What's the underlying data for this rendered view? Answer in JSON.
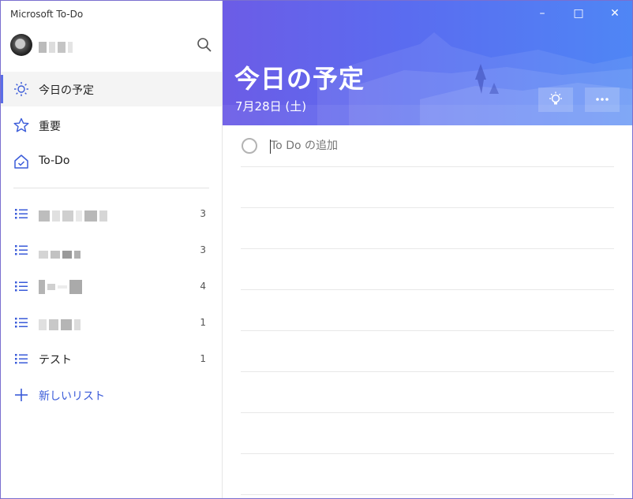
{
  "window": {
    "title": "Microsoft To-Do"
  },
  "user": {
    "name": ""
  },
  "nav": [
    {
      "label": "今日の予定",
      "icon": "sun-icon"
    },
    {
      "label": "重要",
      "icon": "star-icon"
    },
    {
      "label": "To-Do",
      "icon": "home-check-icon"
    }
  ],
  "lists": [
    {
      "label": "",
      "count": "3"
    },
    {
      "label": "",
      "count": "3"
    },
    {
      "label": "",
      "count": "4"
    },
    {
      "label": "",
      "count": "1"
    },
    {
      "label": "テスト",
      "count": "1"
    }
  ],
  "new_list": {
    "label": "新しいリスト"
  },
  "main": {
    "title": "今日の予定",
    "date": "7月28日 (土)",
    "add_placeholder": "To Do の追加"
  },
  "colors": {
    "accent": "#3a5bd9",
    "header_start": "#6c5ce6",
    "header_end": "#4f86f5"
  }
}
